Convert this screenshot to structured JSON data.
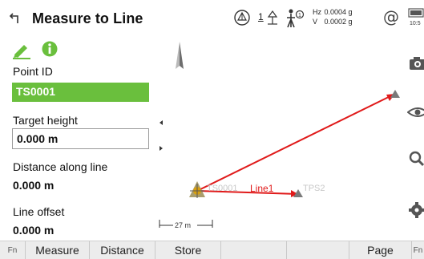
{
  "header": {
    "title": "Measure to Line",
    "target_height_value": "1",
    "hz_label": "Hz",
    "hz_value": "0.0004 g",
    "v_label": "V",
    "v_value": "0.0002 g",
    "at_symbol": "@",
    "time": "10:5"
  },
  "left_panel": {
    "point_id_label": "Point ID",
    "point_id_value": "TS0001",
    "target_height_label": "Target height",
    "target_height_value": "0.000 m",
    "distance_along_label": "Distance along line",
    "distance_along_value": "0.000 m",
    "line_offset_label": "Line offset",
    "line_offset_value": "0.000 m"
  },
  "map": {
    "points": [
      "TS0001",
      "TPS2"
    ],
    "line_label": "Line1",
    "scale_text": "27 m"
  },
  "bottom_bar": {
    "fn": "Fn",
    "measure": "Measure",
    "distance": "Distance",
    "store": "Store",
    "page": "Page",
    "fn_right": "Fn"
  },
  "colors": {
    "accent_green": "#6abf3d",
    "line_red": "#e01a1a",
    "point_gray": "#7a7a7a"
  },
  "icons": [
    "back-arrow-icon",
    "prism-icon",
    "target-height-icon",
    "ppm-icon",
    "battery-icon",
    "pen-icon",
    "info-icon",
    "north-arrow-icon",
    "camera-icon",
    "eye-icon",
    "search-icon",
    "gear-icon"
  ]
}
